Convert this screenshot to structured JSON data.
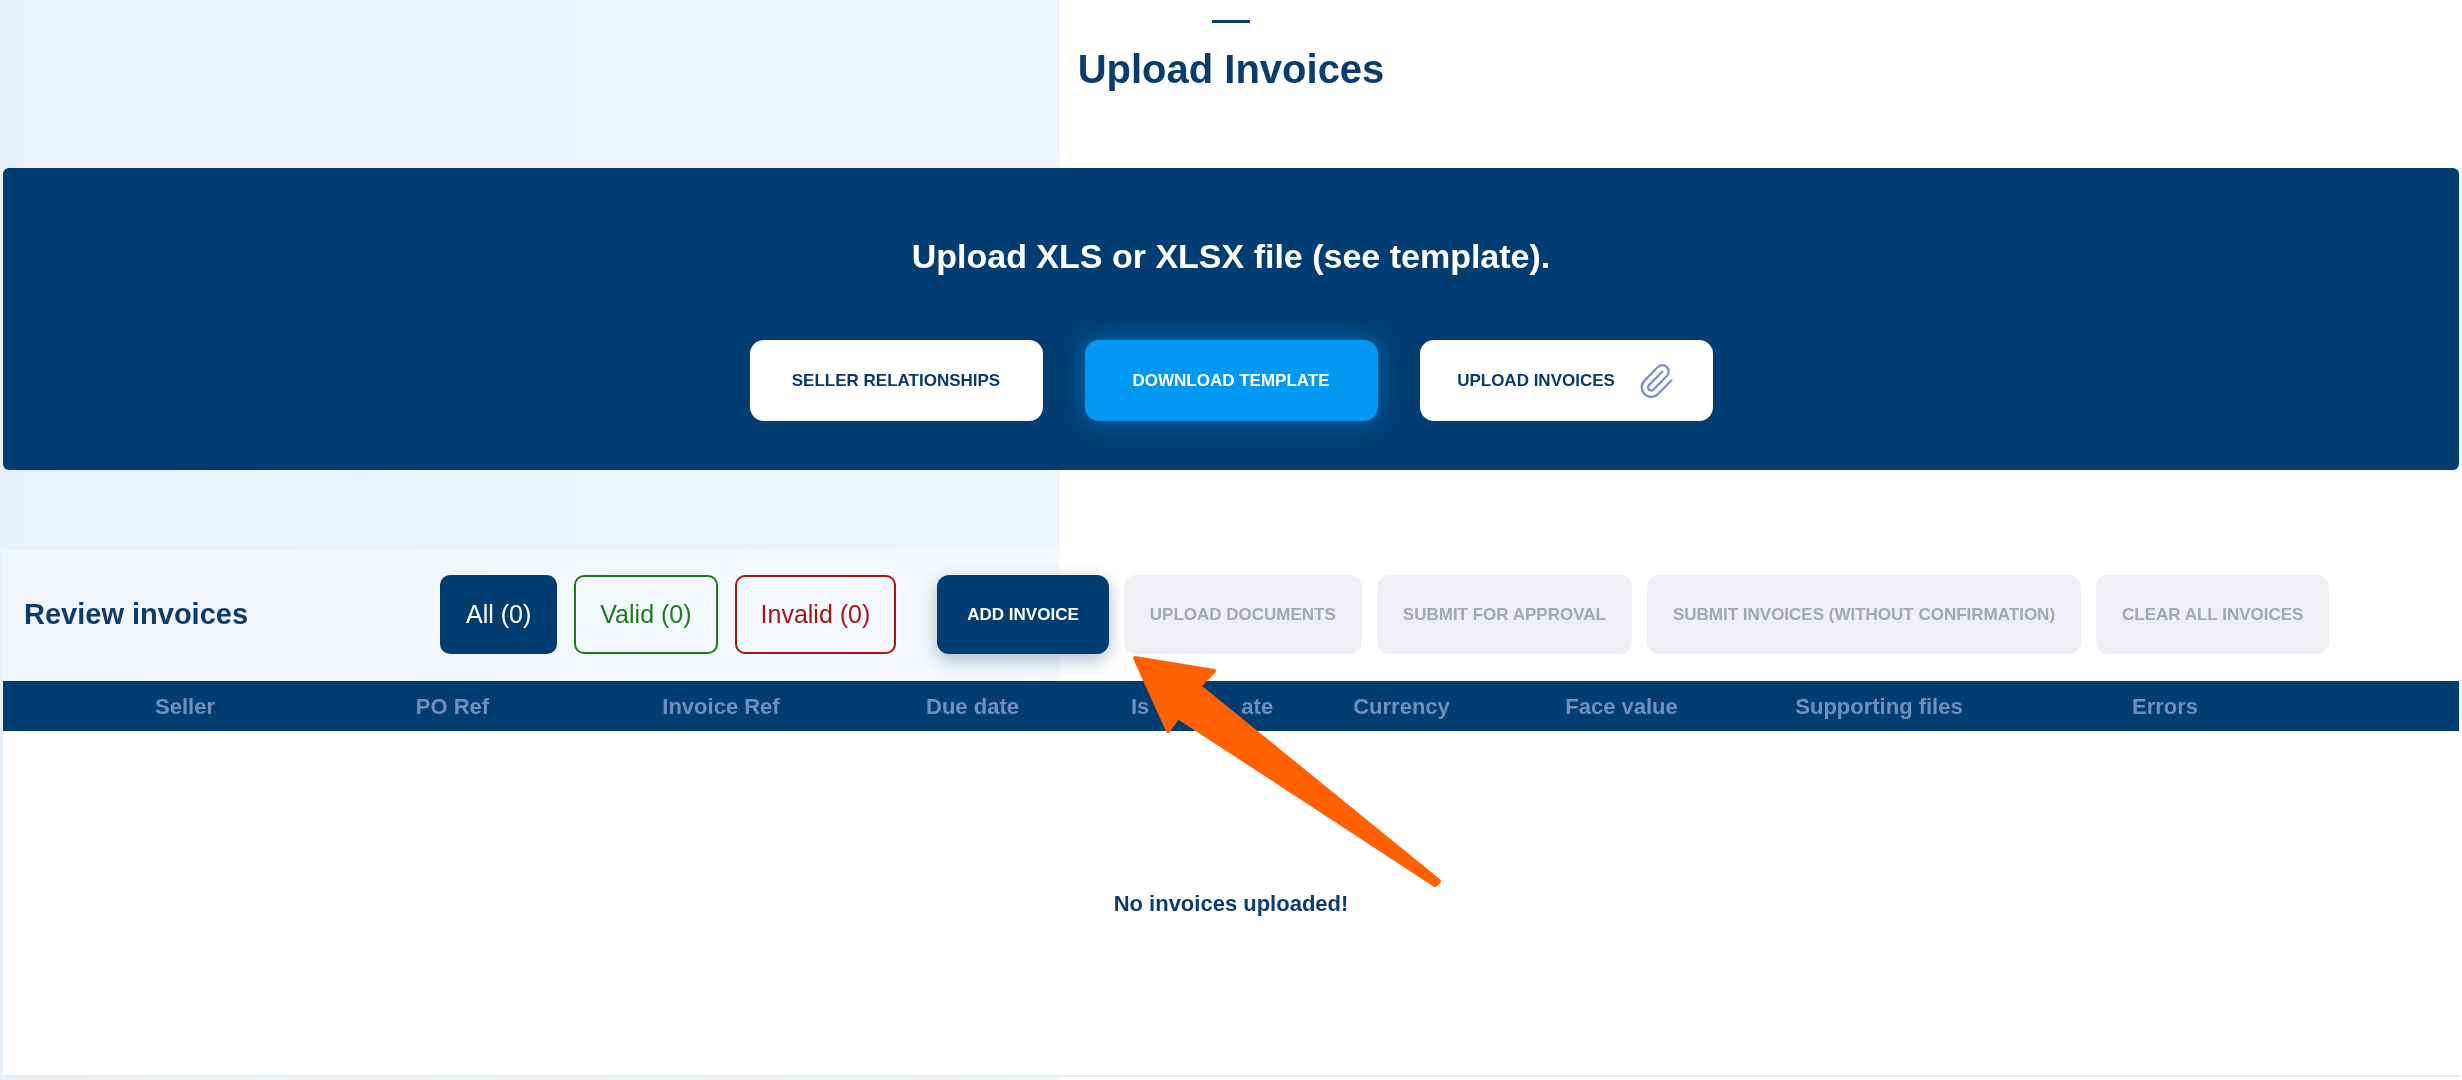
{
  "page": {
    "title": "Upload Invoices"
  },
  "upload_panel": {
    "heading": "Upload XLS or XLSX file (see template).",
    "buttons": [
      {
        "label": "SELLER RELATIONSHIPS",
        "kind": "plain"
      },
      {
        "label": "DOWNLOAD TEMPLATE",
        "kind": "primary"
      },
      {
        "label": "UPLOAD INVOICES",
        "kind": "attach"
      }
    ]
  },
  "review": {
    "title": "Review invoices",
    "filters": [
      {
        "label": "All (0)",
        "selected": true,
        "color": "#013d71"
      },
      {
        "label": "Valid (0)",
        "selected": false,
        "color": "#1d7a1d"
      },
      {
        "label": "Invalid (0)",
        "selected": false,
        "color": "#a51616"
      }
    ],
    "actions": [
      {
        "label": "ADD INVOICE",
        "disabled": false
      },
      {
        "label": "UPLOAD DOCUMENTS",
        "disabled": true
      },
      {
        "label": "SUBMIT FOR APPROVAL",
        "disabled": true
      },
      {
        "label": "SUBMIT INVOICES (WITHOUT CONFIRMATION)",
        "disabled": true
      },
      {
        "label": "CLEAR ALL INVOICES",
        "disabled": true
      }
    ],
    "table": {
      "columns": [
        {
          "label": "Seller"
        },
        {
          "label": "PO Ref"
        },
        {
          "label": "Invoice Ref"
        },
        {
          "label": "Due date"
        },
        {
          "visible_parts": [
            "Is",
            "ate"
          ]
        },
        {
          "label": "Currency"
        },
        {
          "label": "Face value"
        },
        {
          "label": "Supporting files"
        },
        {
          "label": "Errors"
        }
      ],
      "empty_message": "No invoices uploaded!"
    }
  }
}
